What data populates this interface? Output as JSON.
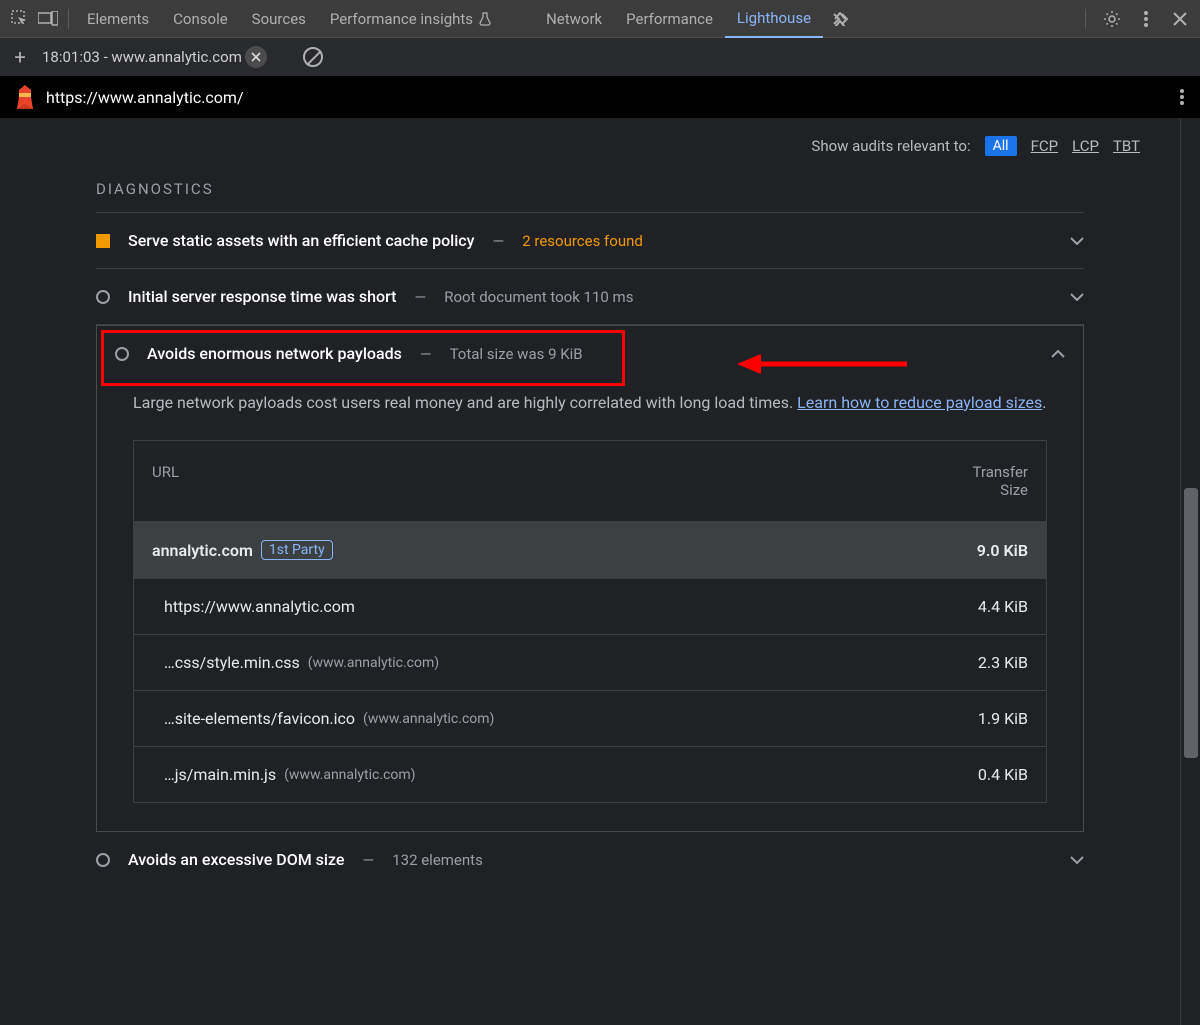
{
  "topTabs": {
    "items": [
      "Elements",
      "Console",
      "Sources",
      "Performance insights",
      "Network",
      "Performance",
      "Lighthouse"
    ],
    "activeIndex": 6
  },
  "secondBar": {
    "tabLabel": "18:01:03 - www.annalytic.com"
  },
  "urlBar": {
    "url": "https://www.annalytic.com/"
  },
  "filter": {
    "label": "Show audits relevant to:",
    "all": "All",
    "metrics": [
      "FCP",
      "LCP",
      "TBT"
    ]
  },
  "diagnosticsTitle": "DIAGNOSTICS",
  "diagItems": [
    {
      "icon": "square",
      "title": "Serve static assets with an efficient cache policy",
      "subtitle": "2 resources found",
      "subClass": "orange"
    },
    {
      "icon": "circle",
      "title": "Initial server response time was short",
      "subtitle": "Root document took 110 ms",
      "subClass": ""
    }
  ],
  "expanded": {
    "title": "Avoids enormous network payloads",
    "subtitle": "Total size was 9 KiB",
    "desc": "Large network payloads cost users real money and are highly correlated with long load times. ",
    "link": "Learn how to reduce payload sizes",
    "descEnd": "."
  },
  "table": {
    "headUrl": "URL",
    "headSizeL1": "Transfer",
    "headSizeL2": "Size",
    "totalHost": "annalytic.com",
    "totalBadge": "1st Party",
    "totalSize": "9.0 KiB",
    "rows": [
      {
        "url": "https://www.annalytic.com",
        "host": "",
        "size": "4.4 KiB"
      },
      {
        "url": "…css/style.min.css",
        "host": "(www.annalytic.com)",
        "size": "2.3 KiB"
      },
      {
        "url": "…site-elements/favicon.ico",
        "host": "(www.annalytic.com)",
        "size": "1.9 KiB"
      },
      {
        "url": "…js/main.min.js",
        "host": "(www.annalytic.com)",
        "size": "0.4 KiB"
      }
    ]
  },
  "afterItem": {
    "title": "Avoids an excessive DOM size",
    "subtitle": "132 elements"
  }
}
